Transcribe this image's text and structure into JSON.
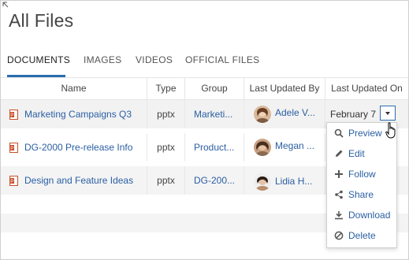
{
  "page": {
    "title": "All Files"
  },
  "tabs": [
    {
      "label": "DOCUMENTS",
      "active": true
    },
    {
      "label": "IMAGES",
      "active": false
    },
    {
      "label": "VIDEOS",
      "active": false
    },
    {
      "label": "OFFICIAL FILES",
      "active": false
    }
  ],
  "columns": [
    "Name",
    "Type",
    "Group",
    "Last Updated By",
    "Last Updated On"
  ],
  "rows": [
    {
      "name": "Marketing Campaigns Q3",
      "type": "pptx",
      "group": "Marketi...",
      "updated_by": "Adele V...",
      "updated_on": "February 7"
    },
    {
      "name": "DG-2000 Pre-release Info",
      "type": "pptx",
      "group": "Product...",
      "updated_by": "Megan ...",
      "updated_on": ""
    },
    {
      "name": "Design and Feature Ideas",
      "type": "pptx",
      "group": "DG-200...",
      "updated_by": "Lidia H...",
      "updated_on": ""
    }
  ],
  "menu": [
    {
      "label": "Preview",
      "icon": "search-icon"
    },
    {
      "label": "Edit",
      "icon": "pencil-icon"
    },
    {
      "label": "Follow",
      "icon": "plus-icon"
    },
    {
      "label": "Share",
      "icon": "share-icon"
    },
    {
      "label": "Download",
      "icon": "download-icon"
    },
    {
      "label": "Delete",
      "icon": "block-icon"
    }
  ],
  "colors": {
    "accent": "#2a6db0",
    "link": "#2a5fa3",
    "pptx": "#c8502a"
  }
}
